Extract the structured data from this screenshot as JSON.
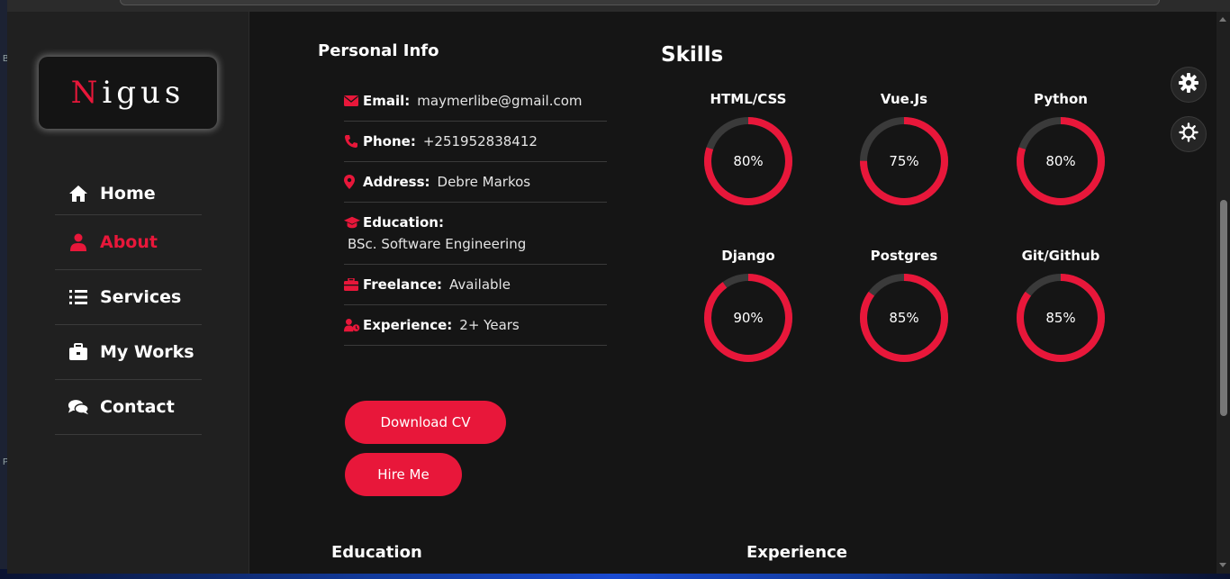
{
  "logo": {
    "first_letter": "N",
    "rest": "igus"
  },
  "nav": {
    "items": [
      {
        "label": "Home",
        "icon": "home-icon"
      },
      {
        "label": "About",
        "icon": "user-icon",
        "active": true
      },
      {
        "label": "Services",
        "icon": "list-icon"
      },
      {
        "label": "My Works",
        "icon": "briefcase-icon"
      },
      {
        "label": "Contact",
        "icon": "chat-icon"
      }
    ]
  },
  "personal_info": {
    "title": "Personal Info",
    "rows": [
      {
        "label": "Email:",
        "value": "maymerlibe@gmail.com",
        "icon": "envelope-icon"
      },
      {
        "label": "Phone:",
        "value": "+251952838412",
        "icon": "phone-icon"
      },
      {
        "label": "Address:",
        "value": "Debre Markos",
        "icon": "map-pin-icon"
      },
      {
        "label": "Education:",
        "value": "BSc. Software Engineering",
        "icon": "graduation-cap-icon"
      },
      {
        "label": "Freelance:",
        "value": "Available",
        "icon": "toolbox-icon"
      },
      {
        "label": "Experience:",
        "value": "2+ Years",
        "icon": "user-clock-icon"
      }
    ]
  },
  "buttons": {
    "download_cv": "Download CV",
    "hire_me": "Hire Me"
  },
  "skills": {
    "title": "Skills",
    "items": [
      {
        "name": "HTML/CSS",
        "percent_label": "80%",
        "percent": 80
      },
      {
        "name": "Vue.Js",
        "percent_label": "75%",
        "percent": 75
      },
      {
        "name": "Python",
        "percent_label": "80%",
        "percent": 80
      },
      {
        "name": "Django",
        "percent_label": "90%",
        "percent": 90
      },
      {
        "name": "Postgres",
        "percent_label": "85%",
        "percent": 85
      },
      {
        "name": "Git/Github",
        "percent_label": "85%",
        "percent": 85
      }
    ]
  },
  "sections": {
    "education": "Education",
    "experience": "Experience"
  },
  "colors": {
    "accent": "#e8173a",
    "background": "#151515",
    "sidebar": "#202020",
    "track": "#3a3a3a"
  }
}
